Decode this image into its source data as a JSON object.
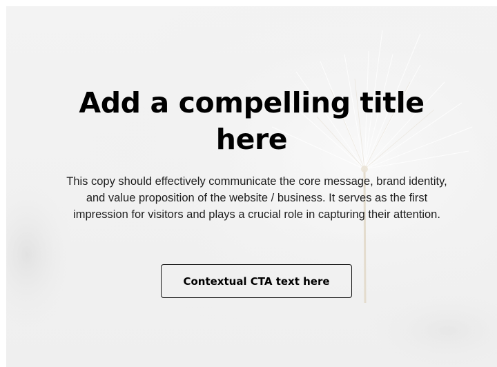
{
  "hero": {
    "title_line_1": "Add a compelling title",
    "title_line_2": "here",
    "copy": "This copy should effectively communicate the core message, brand identity, and value proposition of the website / business. It serves as the first impression for visitors and plays a crucial role in capturing their attention.",
    "cta_label": "Contextual CTA text here",
    "background_image": "dandelion-seed-photo"
  },
  "colors": {
    "background": "#f2f2f2",
    "text": "#000000",
    "body_text": "#1d1d1d",
    "button_border": "#111111"
  }
}
